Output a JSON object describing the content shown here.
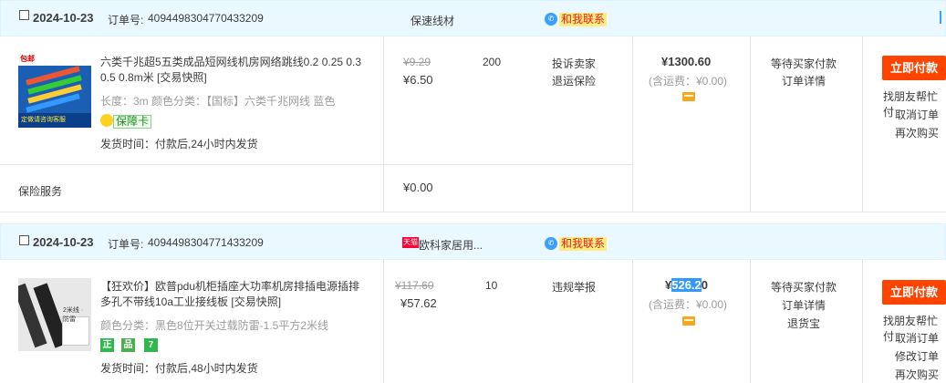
{
  "orders": [
    {
      "date": "2024-10-23",
      "order_label": "订单号:",
      "order_no": "4094498304770433209",
      "shop": "保速线材",
      "shop_badge": "",
      "contact": "和我联系",
      "product_title": "六类千兆超5五类成品短网线机房网络跳线0.2 0.25 0.3 0.5 0.8m米 [交易快照]",
      "spec": "长度：3m  颜色分类：【国标】六类千兆网线 蓝色",
      "guarantee": "保障卡",
      "ship": "发货时间：付款后,24小时内发货",
      "orig_price": "¥9.29",
      "price": "¥6.50",
      "qty": "200",
      "after_sale": [
        "投诉卖家",
        "退运保险"
      ],
      "total": "¥1300.60",
      "freight": "(含运费：¥0.00)",
      "status": [
        "等待买家付款",
        "订单详情"
      ],
      "pay_btn": "立即付款",
      "actions": [
        "找朋友帮忙付",
        "取消订单",
        "再次购买"
      ],
      "service_label": "保险服务",
      "service_price": "¥0.00",
      "thumb_top": "包邮",
      "thumb_bottom": "定做请咨询客服"
    },
    {
      "date": "2024-10-23",
      "order_label": "订单号:",
      "order_no": "4094498304771433209",
      "shop": "欧科家居用...",
      "shop_badge": "天猫",
      "contact": "和我联系",
      "product_title": "【狂欢价】欧普pdu机柜插座大功率机房排插电源插排多孔不带线10a工业接线板 [交易快照]",
      "spec": "颜色分类：黑色8位开关过载防雷-1.5平方2米线",
      "badges": [
        "正",
        "品",
        "7"
      ],
      "ship": "发货时间：付款后,48小时内发货",
      "orig_price": "¥117.60",
      "price": "¥57.62",
      "qty": "10",
      "after_sale": [
        "违规举报"
      ],
      "total_prefix": "¥",
      "total_selected": "526.2",
      "total_suffix": "0",
      "freight": "(含运费：¥0.00)",
      "status": [
        "等待买家付款",
        "订单详情",
        "退货宝"
      ],
      "pay_btn": "立即付款",
      "actions": [
        "找朋友帮忙付",
        "取消订单",
        "修改订单",
        "再次购买"
      ],
      "thumb_label": "2米线 · 防雷"
    }
  ],
  "colors": {
    "accent": "#ff4400",
    "header_bg": "#eaf8ff",
    "selection": "#3399ff"
  }
}
